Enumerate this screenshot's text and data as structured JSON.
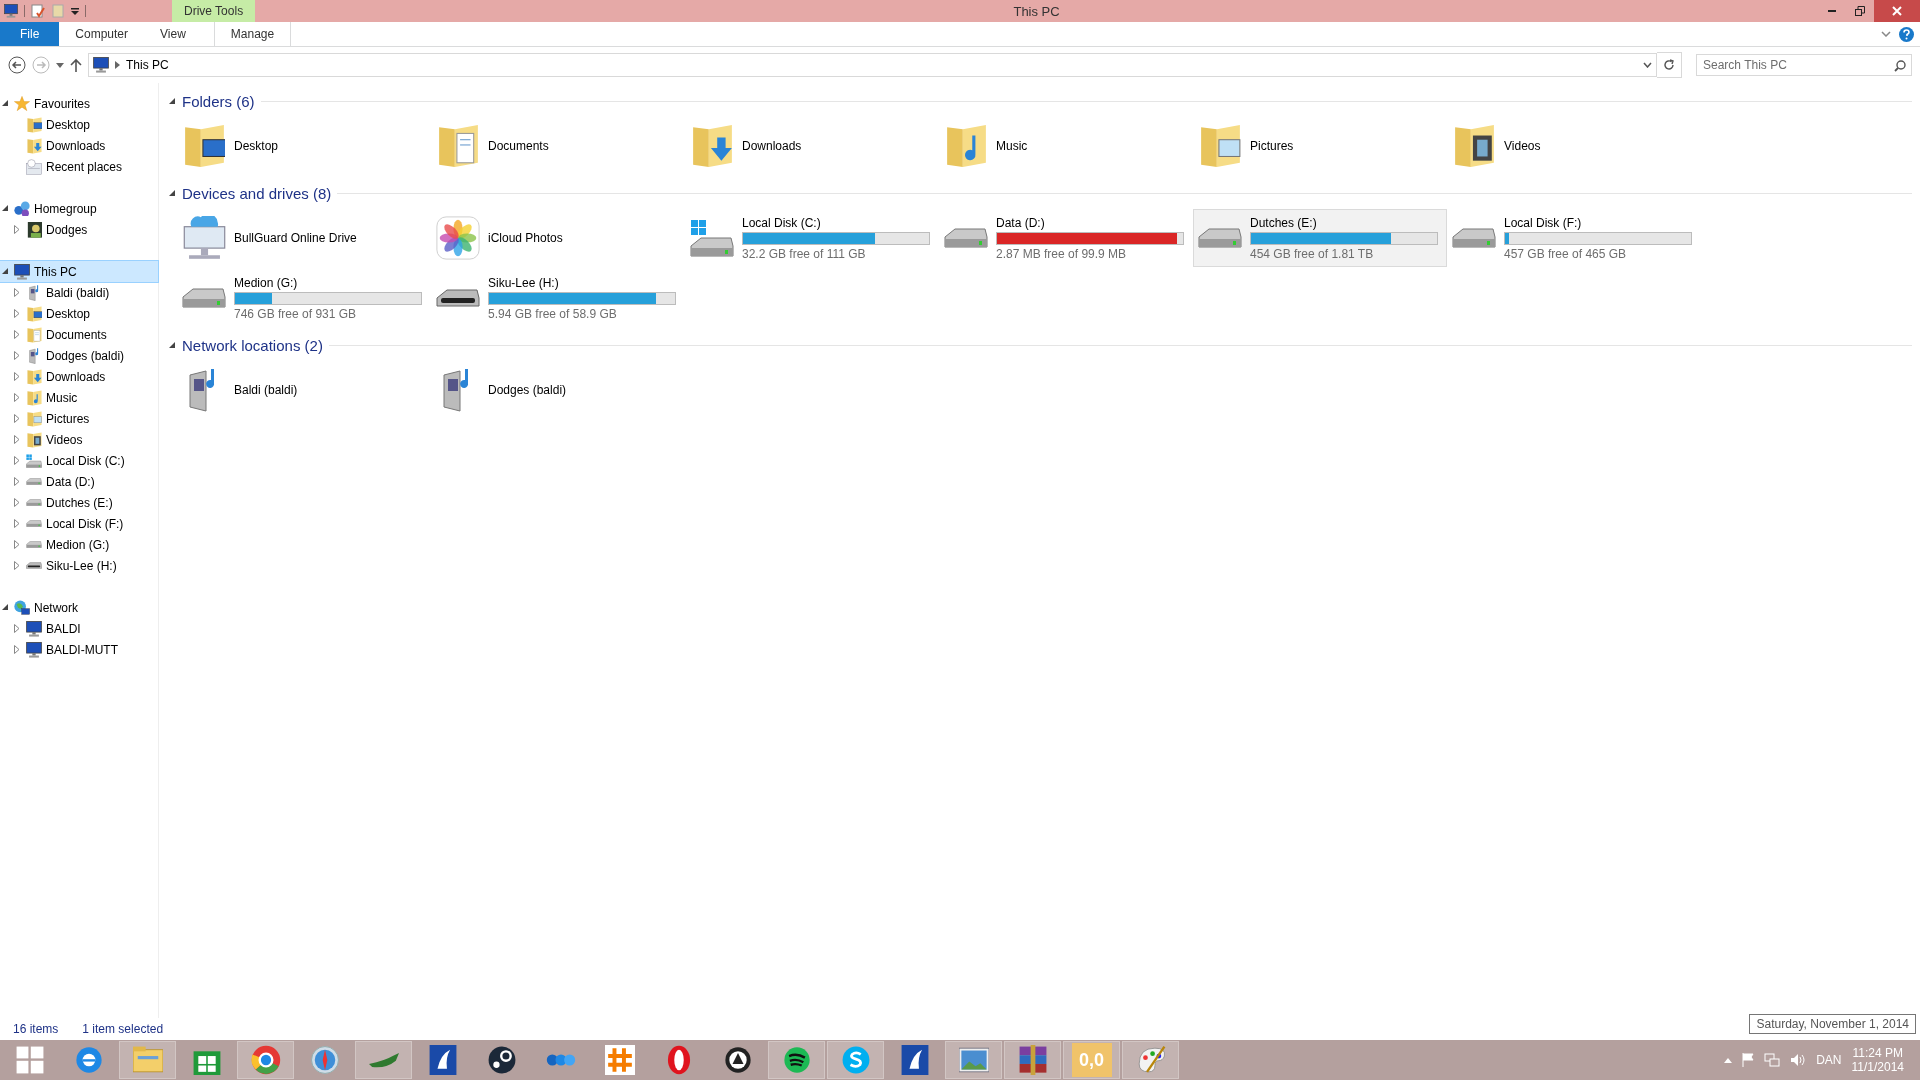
{
  "window": {
    "title": "This PC",
    "context_tab": "Drive Tools"
  },
  "ribbon": {
    "tabs": [
      {
        "label": "File",
        "kind": "file",
        "selected": false
      },
      {
        "label": "Computer",
        "kind": "tab",
        "selected": false
      },
      {
        "label": "View",
        "kind": "tab",
        "selected": false
      },
      {
        "label": "Manage",
        "kind": "context",
        "selected": false
      }
    ]
  },
  "address": {
    "path": "This PC",
    "search": {
      "placeholder": "Search This PC"
    }
  },
  "sidebar": {
    "groups": [
      {
        "label": "Favourites",
        "kind": "star",
        "expanded": true,
        "selected": false,
        "children": [
          {
            "label": "Desktop",
            "kind": "desktop"
          },
          {
            "label": "Downloads",
            "kind": "downloads"
          },
          {
            "label": "Recent places",
            "kind": "recent"
          }
        ]
      },
      {
        "label": "Homegroup",
        "kind": "homegroup",
        "expanded": true,
        "selected": false,
        "children": [
          {
            "label": "Dodges",
            "kind": "user",
            "expanded": false
          }
        ]
      },
      {
        "label": "This PC",
        "kind": "pc",
        "expanded": true,
        "selected": true,
        "children": [
          {
            "label": "Baldi (baldi)",
            "kind": "media",
            "expanded": false
          },
          {
            "label": "Desktop",
            "kind": "desktop",
            "expanded": false
          },
          {
            "label": "Documents",
            "kind": "documents",
            "expanded": false
          },
          {
            "label": "Dodges (baldi)",
            "kind": "media",
            "expanded": false
          },
          {
            "label": "Downloads",
            "kind": "downloads",
            "expanded": false
          },
          {
            "label": "Music",
            "kind": "music",
            "expanded": false
          },
          {
            "label": "Pictures",
            "kind": "pictures",
            "expanded": false
          },
          {
            "label": "Videos",
            "kind": "videos",
            "expanded": false
          },
          {
            "label": "Local Disk (C:)",
            "kind": "windisk",
            "expanded": false
          },
          {
            "label": "Data (D:)",
            "kind": "disk",
            "expanded": false
          },
          {
            "label": "Dutches (E:)",
            "kind": "disk",
            "expanded": false
          },
          {
            "label": "Local Disk (F:)",
            "kind": "disk",
            "expanded": false
          },
          {
            "label": "Medion (G:)",
            "kind": "disk",
            "expanded": false
          },
          {
            "label": "Siku-Lee (H:)",
            "kind": "removable",
            "expanded": false
          }
        ]
      },
      {
        "label": "Network",
        "kind": "network",
        "expanded": true,
        "selected": false,
        "children": [
          {
            "label": "BALDI",
            "kind": "pc",
            "expanded": false
          },
          {
            "label": "BALDI-MUTT",
            "kind": "pc",
            "expanded": false
          }
        ]
      }
    ]
  },
  "sections": [
    {
      "title": "Folders (6)",
      "expanded": true,
      "items": [
        {
          "kind": "desktop",
          "name": "Desktop",
          "selected": false
        },
        {
          "kind": "documents",
          "name": "Documents",
          "selected": false
        },
        {
          "kind": "downloads",
          "name": "Downloads",
          "selected": false
        },
        {
          "kind": "music",
          "name": "Music",
          "selected": false
        },
        {
          "kind": "pictures",
          "name": "Pictures",
          "selected": false
        },
        {
          "kind": "videos",
          "name": "Videos",
          "selected": false
        }
      ]
    },
    {
      "title": "Devices and drives (8)",
      "expanded": true,
      "items": [
        {
          "kind": "cloud",
          "name": "BullGuard Online Drive",
          "selected": false
        },
        {
          "kind": "photos",
          "name": "iCloud Photos",
          "selected": false
        },
        {
          "kind": "windisk",
          "name": "Local Disk (C:)",
          "level": 0.71,
          "low_space": false,
          "space": "32.2 GB free of 111 GB",
          "selected": false
        },
        {
          "kind": "disk",
          "name": "Data (D:)",
          "level": 0.97,
          "low_space": true,
          "space": "2.87 MB free of 99.9 MB",
          "selected": false
        },
        {
          "kind": "disk",
          "name": "Dutches (E:)",
          "level": 0.75,
          "low_space": false,
          "space": "454 GB free of 1.81 TB",
          "selected": true
        },
        {
          "kind": "disk",
          "name": "Local Disk (F:)",
          "level": 0.02,
          "low_space": false,
          "space": "457 GB free of 465 GB",
          "selected": false
        },
        {
          "kind": "disk",
          "name": "Medion (G:)",
          "level": 0.2,
          "low_space": false,
          "space": "746 GB free of 931 GB",
          "selected": false
        },
        {
          "kind": "removable",
          "name": "Siku-Lee (H:)",
          "level": 0.9,
          "low_space": false,
          "space": "5.94 GB free of 58.9 GB",
          "selected": false
        }
      ]
    },
    {
      "title": "Network locations (2)",
      "expanded": true,
      "items": [
        {
          "kind": "media",
          "name": "Baldi (baldi)",
          "selected": false
        },
        {
          "kind": "media",
          "name": "Dodges (baldi)",
          "selected": false
        }
      ]
    }
  ],
  "status_bar": {
    "count": "16 items",
    "selection": "1 item selected"
  },
  "tooltip": "Saturday, November 1, 2014",
  "taskbar": {
    "apps": [
      {
        "kind": "start",
        "running": false
      },
      {
        "kind": "browser-e",
        "running": false
      },
      {
        "kind": "explorer",
        "running": true
      },
      {
        "kind": "store",
        "running": false
      },
      {
        "kind": "chrome",
        "running": true
      },
      {
        "kind": "compass",
        "running": false
      },
      {
        "kind": "lamp",
        "running": true
      },
      {
        "kind": "bird",
        "running": false
      },
      {
        "kind": "steam",
        "running": false
      },
      {
        "kind": "dots",
        "running": false
      },
      {
        "kind": "hash",
        "running": false
      },
      {
        "kind": "opera",
        "running": false
      },
      {
        "kind": "ring",
        "running": false
      },
      {
        "kind": "spotify",
        "running": true
      },
      {
        "kind": "skype",
        "running": true
      },
      {
        "kind": "bird",
        "running": false
      },
      {
        "kind": "photo",
        "running": true
      },
      {
        "kind": "archive",
        "running": true
      },
      {
        "kind": "counter",
        "label": "0,0",
        "running": true
      },
      {
        "kind": "paint",
        "running": true
      }
    ],
    "tray": {
      "language": "DAN",
      "time": "11:24 PM",
      "date": "11/1/2014"
    }
  }
}
